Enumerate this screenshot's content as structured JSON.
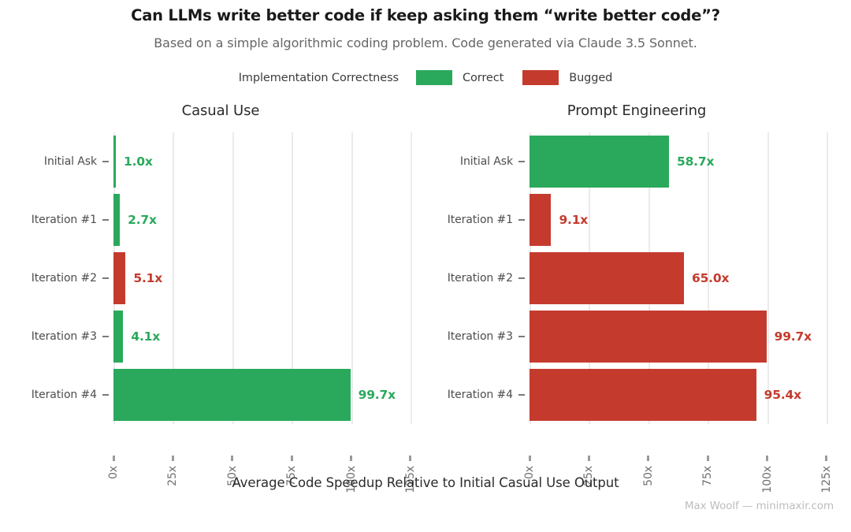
{
  "chart_data": {
    "type": "bar",
    "orientation": "horizontal",
    "title": "Can LLMs write better code if keep asking them “write better code”?",
    "subtitle": "Based on a simple algorithmic coding problem. Code generated via Claude 3.5 Sonnet.",
    "xlabel": "Average Code Speedup Relative to Initial Casual Use Output",
    "ylabel": "",
    "xlim": [
      0,
      130
    ],
    "xticks": [
      0,
      25,
      50,
      75,
      100,
      125
    ],
    "xticklabels": [
      "0x",
      "25x",
      "50x",
      "75x",
      "100x",
      "125x"
    ],
    "grid": "vertical",
    "legend": {
      "title": "Implementation Correctness",
      "position": "top-center",
      "entries": [
        {
          "label": "Correct",
          "color": "#2aa95c"
        },
        {
          "label": "Bugged",
          "color": "#c43b2e"
        }
      ]
    },
    "categories": [
      "Initial Ask",
      "Iteration #1",
      "Iteration #2",
      "Iteration #3",
      "Iteration #4"
    ],
    "facets": [
      {
        "name": "Casual Use",
        "values": [
          1.0,
          2.7,
          5.1,
          4.1,
          99.7
        ],
        "labels": [
          "1.0x",
          "2.7x",
          "5.1x",
          "4.1x",
          "99.7x"
        ],
        "correctness": [
          "Correct",
          "Correct",
          "Bugged",
          "Correct",
          "Correct"
        ],
        "colors": [
          "#2aa95c",
          "#2aa95c",
          "#c43b2e",
          "#2aa95c",
          "#2aa95c"
        ]
      },
      {
        "name": "Prompt Engineering",
        "values": [
          58.7,
          9.1,
          65.0,
          99.7,
          95.4
        ],
        "labels": [
          "58.7x",
          "9.1x",
          "65.0x",
          "99.7x",
          "95.4x"
        ],
        "correctness": [
          "Correct",
          "Bugged",
          "Bugged",
          "Bugged",
          "Bugged"
        ],
        "colors": [
          "#2aa95c",
          "#c43b2e",
          "#c43b2e",
          "#c43b2e",
          "#c43b2e"
        ]
      }
    ],
    "credit": "Max Woolf — minimaxir.com"
  },
  "colors": {
    "correct": "#2aa95c",
    "bugged": "#c43b2e",
    "grid": "#ebebeb",
    "text": "#3c3c3c",
    "subtitle": "#666666",
    "credit": "#bdbdbd"
  }
}
